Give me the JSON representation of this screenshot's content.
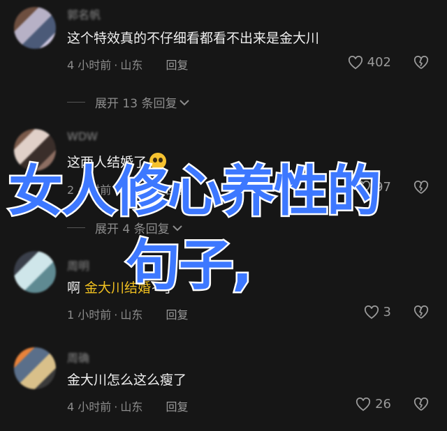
{
  "comments": [
    {
      "username": "郭名帆",
      "text": "这个特效真的不仔细看都看不出来是金大川",
      "time": "4 小时前",
      "location": "山东",
      "reply_label": "回复",
      "likes": "402",
      "expand_label": "展开 13 条回复"
    },
    {
      "username": "WDW",
      "text": "这两人结婚了",
      "time": "2 小时前",
      "location": "山东",
      "reply_label": "回复",
      "likes": "97",
      "expand_label": "展开 4 条回复"
    },
    {
      "username": "周明",
      "text_prefix": "啊 ",
      "mention": "金大川结婚",
      "text_suffix": "~了",
      "time": "1 小时前",
      "location": "山东",
      "reply_label": "回复",
      "likes": "3"
    },
    {
      "username": "周确",
      "text": "金大川怎么这么瘦了",
      "time": "4 小时前",
      "location": "山东",
      "reply_label": "回复",
      "likes": "26"
    }
  ],
  "overlay": {
    "line1": "女人修心养性的",
    "line2": "句子,"
  },
  "colors": {
    "background": "#161616",
    "overlay_text": "#3d78ff",
    "mention": "#f0c020"
  },
  "icons": [
    "heart-icon",
    "broken-heart-icon",
    "chevron-down-icon",
    "emoji-icon"
  ]
}
